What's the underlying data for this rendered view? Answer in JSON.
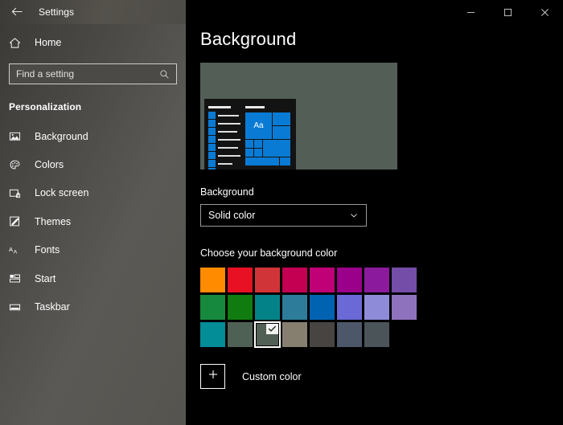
{
  "window": {
    "title": "Settings",
    "back_icon": "back-arrow-icon",
    "minimize_label": "–",
    "maximize_label": "☐",
    "close_label": "✕"
  },
  "sidebar": {
    "home": {
      "label": "Home",
      "icon": "home-icon"
    },
    "search": {
      "placeholder": "Find a setting",
      "value": "",
      "icon": "search-icon"
    },
    "group_title": "Personalization",
    "items": [
      {
        "label": "Background",
        "icon": "picture-icon",
        "selected": true
      },
      {
        "label": "Colors",
        "icon": "palette-icon",
        "selected": false
      },
      {
        "label": "Lock screen",
        "icon": "lock-screen-icon",
        "selected": false
      },
      {
        "label": "Themes",
        "icon": "themes-brush-icon",
        "selected": false
      },
      {
        "label": "Fonts",
        "icon": "fonts-aa-icon",
        "selected": false
      },
      {
        "label": "Start",
        "icon": "start-tiles-icon",
        "selected": false
      },
      {
        "label": "Taskbar",
        "icon": "taskbar-icon",
        "selected": false
      }
    ]
  },
  "main": {
    "page_title": "Background",
    "preview": {
      "desktop_color": "#535f56",
      "start_menu_bg": "#131313",
      "tile_color": "#0a7bd4",
      "tile_text": "Aa"
    },
    "background_section": {
      "label": "Background",
      "dropdown_value": "Solid color",
      "dropdown_icon": "chevron-down-icon"
    },
    "color_section": {
      "label": "Choose your background color",
      "rows": [
        [
          {
            "hex": "#ff8c00",
            "selected": false
          },
          {
            "hex": "#e81123",
            "selected": false
          },
          {
            "hex": "#d13438",
            "selected": false
          },
          {
            "hex": "#c30052",
            "selected": false
          },
          {
            "hex": "#bf0077",
            "selected": false
          },
          {
            "hex": "#9a0089",
            "selected": false
          },
          {
            "hex": "#8b1a9c",
            "selected": false
          },
          {
            "hex": "#744da9",
            "selected": false
          }
        ],
        [
          {
            "hex": "#16893e",
            "selected": false
          },
          {
            "hex": "#107c10",
            "selected": false
          },
          {
            "hex": "#038387",
            "selected": false
          },
          {
            "hex": "#2d7d9a",
            "selected": false
          },
          {
            "hex": "#0063b1",
            "selected": false
          },
          {
            "hex": "#6b69d6",
            "selected": false
          },
          {
            "hex": "#8e8cd8",
            "selected": false
          },
          {
            "hex": "#8f72bd",
            "selected": false
          }
        ],
        [
          {
            "hex": "#038d97",
            "selected": false
          },
          {
            "hex": "#4f6154",
            "selected": false
          },
          {
            "hex": "#525f55",
            "selected": true
          },
          {
            "hex": "#867f70",
            "selected": false
          },
          {
            "hex": "#474442",
            "selected": false
          },
          {
            "hex": "#4c5769",
            "selected": false
          },
          {
            "hex": "#4a5459",
            "selected": false
          }
        ]
      ],
      "selected_check_icon": "check-icon"
    },
    "custom": {
      "button_icon": "plus-icon",
      "label": "Custom color"
    }
  }
}
